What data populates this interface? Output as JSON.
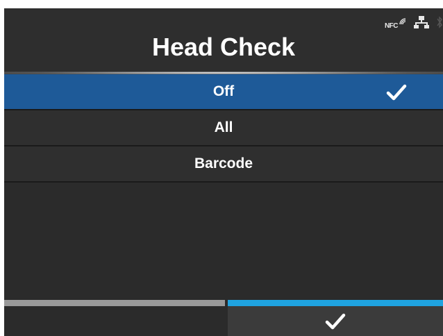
{
  "header": {
    "title": "Head Check",
    "status": {
      "nfc_label": "NFC",
      "icons": [
        "nfc-icon",
        "network-icon",
        "bluetooth-icon"
      ]
    }
  },
  "list": {
    "items": [
      {
        "label": "Off",
        "selected": true
      },
      {
        "label": "All",
        "selected": false
      },
      {
        "label": "Barcode",
        "selected": false
      }
    ]
  },
  "footer": {
    "left_key": "",
    "right_key_icon": "check-icon"
  },
  "colors": {
    "selected_bg": "#1e5a98",
    "accent": "#1fa3e0",
    "background": "#2b2b2b"
  }
}
